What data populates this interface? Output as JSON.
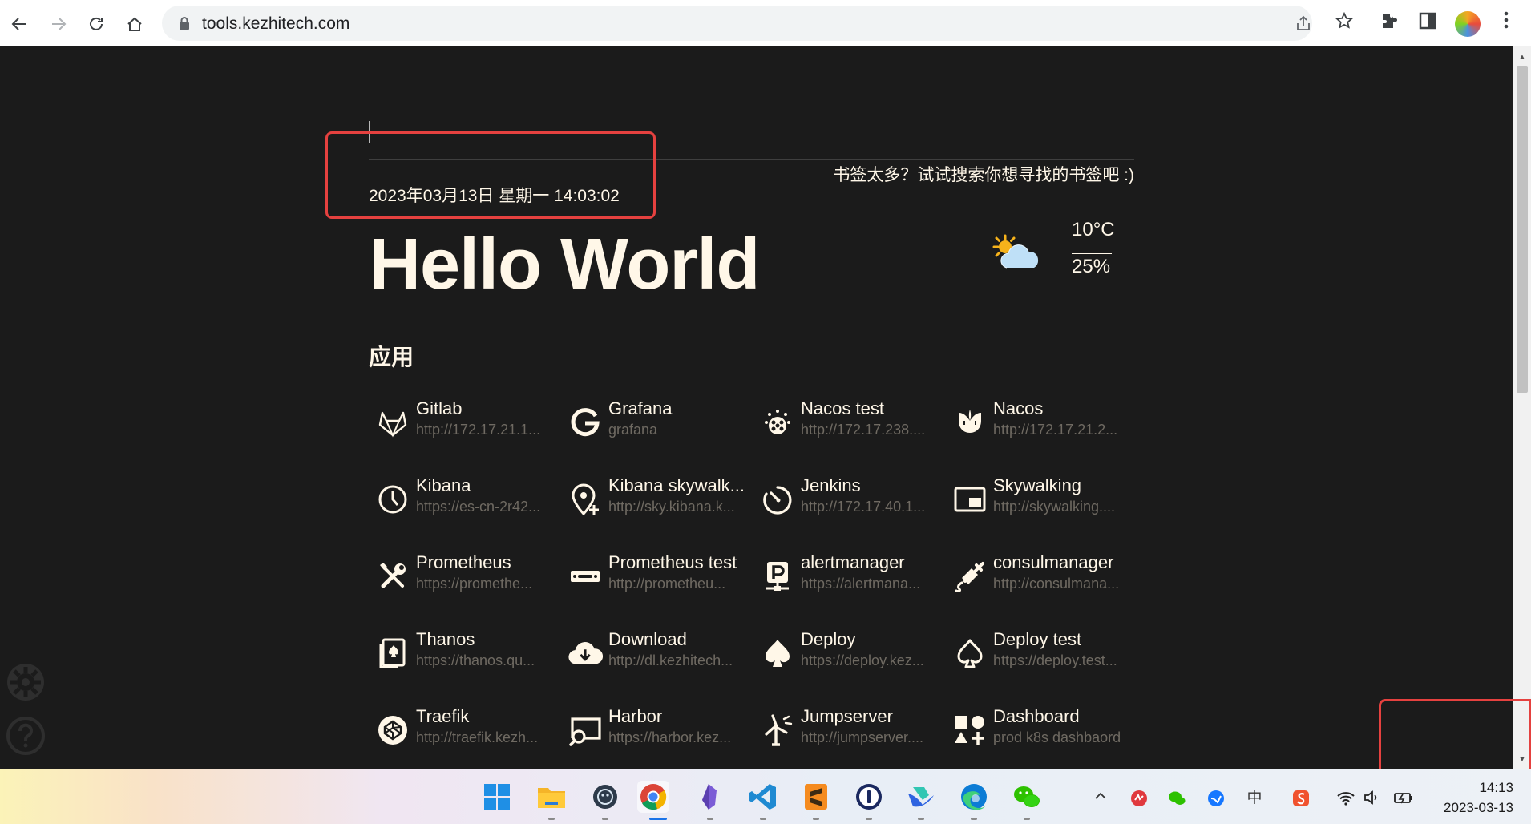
{
  "browser": {
    "url": "tools.kezhitech.com",
    "nav_icons": [
      "back-arrow-icon",
      "forward-arrow-icon",
      "reload-icon",
      "home-icon"
    ],
    "toolbar_icons": [
      "share-icon",
      "star-icon",
      "extensions-icon",
      "sidepanel-icon",
      "avatar",
      "menu-icon"
    ]
  },
  "page": {
    "search_hint": "书签太多？试试搜索你想寻找的书签吧 :)",
    "datetime": "2023年03月13日 星期一 14:03:02",
    "greeting": "Hello World",
    "weather": {
      "temperature": "10°C",
      "humidity": "25%",
      "icon": "partly-cloudy-icon"
    },
    "section_title": "应用",
    "bookmarks": [
      {
        "name": "Gitlab",
        "url": "http://172.17.21.1...",
        "icon": "gitlab-icon"
      },
      {
        "name": "Grafana",
        "url": "grafana",
        "icon": "grafana-icon"
      },
      {
        "name": "Nacos test",
        "url": "http://172.17.238....",
        "icon": "nacos-test-icon"
      },
      {
        "name": "Nacos",
        "url": "http://172.17.21.2...",
        "icon": "nacos-icon"
      },
      {
        "name": "Kibana",
        "url": "https://es-cn-2r42...",
        "icon": "clock-icon"
      },
      {
        "name": "Kibana skywalk...",
        "url": "http://sky.kibana.k...",
        "icon": "map-pin-plus-icon"
      },
      {
        "name": "Jenkins",
        "url": "http://172.17.40.1...",
        "icon": "timer-icon"
      },
      {
        "name": "Skywalking",
        "url": "http://skywalking....",
        "icon": "picture-in-picture-icon"
      },
      {
        "name": "Prometheus",
        "url": "https://promethe...",
        "icon": "tools-icon"
      },
      {
        "name": "Prometheus test",
        "url": "http://prometheu...",
        "icon": "razor-icon"
      },
      {
        "name": "alertmanager",
        "url": "https://alertmana...",
        "icon": "parking-network-icon"
      },
      {
        "name": "consulmanager",
        "url": "http://consulmana...",
        "icon": "syringe-icon"
      },
      {
        "name": "Thanos",
        "url": "https://thanos.qu...",
        "icon": "cards-icon"
      },
      {
        "name": "Download",
        "url": "http://dl.kezhitech...",
        "icon": "cloud-download-icon"
      },
      {
        "name": "Deploy",
        "url": "https://deploy.kez...",
        "icon": "spade-icon"
      },
      {
        "name": "Deploy test",
        "url": "https://deploy.test...",
        "icon": "spade-outline-icon"
      },
      {
        "name": "Traefik",
        "url": "http://traefik.kezh...",
        "icon": "codepen-icon"
      },
      {
        "name": "Harbor",
        "url": "https://harbor.kez...",
        "icon": "screen-search-icon"
      },
      {
        "name": "Jumpserver",
        "url": "http://jumpserver....",
        "icon": "wind-turbine-icon"
      },
      {
        "name": "Dashboard",
        "url": "prod k8s dashbaord",
        "icon": "shapes-icon"
      }
    ],
    "side_buttons": [
      "settings-icon",
      "help-icon"
    ]
  },
  "taskbar": {
    "apps": [
      "windows-start-icon",
      "file-explorer-icon",
      "app-icon",
      "chrome-icon",
      "obsidian-icon",
      "vscode-icon",
      "sublime-icon",
      "1password-icon",
      "feishu-icon",
      "edge-icon",
      "wechat-icon"
    ],
    "tray_icons": [
      "chevron-up-icon",
      "tray-app-icon",
      "wechat-tray-icon",
      "tray-bird-icon",
      "ime-icon",
      "sogou-icon",
      "wifi-icon",
      "volume-icon",
      "battery-icon"
    ],
    "ime_label": "中",
    "clock_time": "14:13",
    "clock_date": "2023-03-13"
  }
}
